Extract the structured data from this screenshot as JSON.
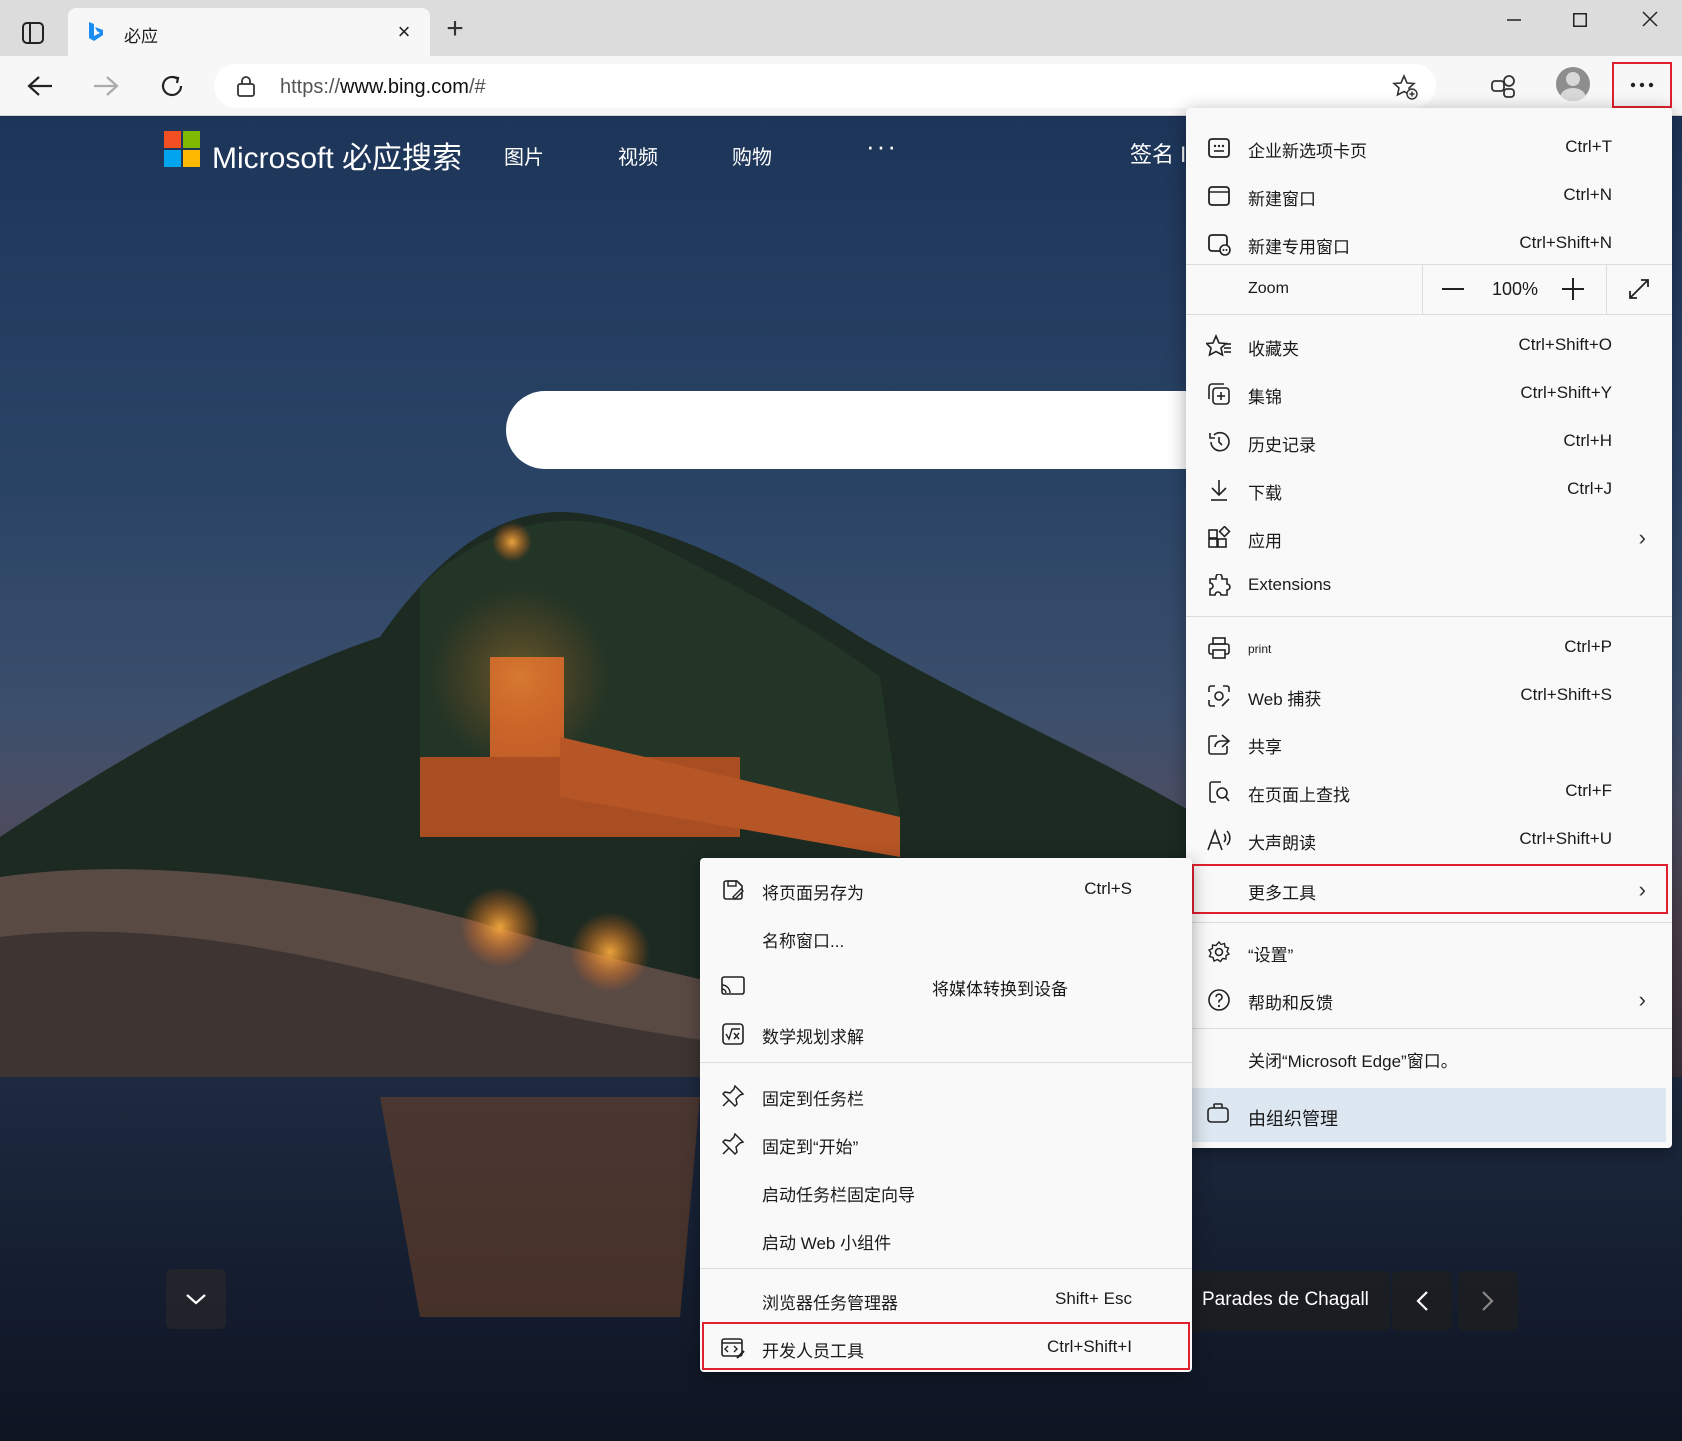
{
  "browser": {
    "tab_title": "必应",
    "url_scheme": "https://",
    "url_host": "www.bing.com",
    "url_path": "/#"
  },
  "page": {
    "brand": "Microsoft 必应搜索",
    "nav": [
      "图片",
      "视频",
      "购物"
    ],
    "nav_more": "···",
    "signin": "签名 I",
    "image_caption": "Parades de Chagall"
  },
  "menu": {
    "items_top": [
      {
        "label": "企业新选项卡页",
        "shortcut": "Ctrl+T",
        "icon": "business-tab-icon"
      },
      {
        "label": "新建窗口",
        "shortcut": "Ctrl+N",
        "icon": "new-window-icon"
      },
      {
        "label": "新建专用窗口",
        "shortcut": "Ctrl+Shift+N",
        "icon": "inprivate-window-icon"
      }
    ],
    "zoom_label": "Zoom",
    "zoom_value": "100%",
    "zoom_minus": "—",
    "zoom_plus": "+",
    "items_mid": [
      {
        "label": "收藏夹",
        "shortcut": "Ctrl+Shift+O",
        "icon": "favorites-icon"
      },
      {
        "label": "集锦",
        "shortcut": "Ctrl+Shift+Y",
        "icon": "collections-icon"
      },
      {
        "label": "历史记录",
        "shortcut": "Ctrl+H",
        "icon": "history-icon"
      },
      {
        "label": "下载",
        "shortcut": "Ctrl+J",
        "icon": "download-icon"
      },
      {
        "label": "应用",
        "shortcut": "",
        "icon": "apps-icon"
      },
      {
        "label": "Extensions",
        "shortcut": "",
        "icon": "extensions-icon"
      }
    ],
    "items_tools": [
      {
        "label": "print",
        "shortcut": "Ctrl+P",
        "icon": "print-icon"
      },
      {
        "label": "Web 捕获",
        "shortcut": "Ctrl+Shift+S",
        "icon": "web-capture-icon"
      },
      {
        "label": "共享",
        "shortcut": "",
        "icon": "share-icon"
      },
      {
        "label": "在页面上查找",
        "shortcut": "Ctrl+F",
        "icon": "find-icon"
      },
      {
        "label": "大声朗读",
        "shortcut": "Ctrl+Shift+U",
        "icon": "read-aloud-icon"
      },
      {
        "label": "更多工具",
        "shortcut": "",
        "icon": ""
      }
    ],
    "settings": "“设置”",
    "help": "帮助和反馈",
    "close": "关闭“Microsoft Edge”窗口。",
    "managed": "由组织管理",
    "chevron": "›"
  },
  "submenu": {
    "items": [
      {
        "label": "将页面另存为",
        "shortcut": "Ctrl+S",
        "icon": "save-page-icon"
      },
      {
        "label": "名称窗口...",
        "shortcut": "",
        "icon": ""
      },
      {
        "label": "将媒体转换到设备",
        "shortcut": "",
        "icon": "cast-icon"
      },
      {
        "label": "数学规划求解",
        "shortcut": "",
        "icon": "math-solver-icon"
      }
    ],
    "pin_items": [
      {
        "label": "固定到任务栏",
        "icon": "pin-icon"
      },
      {
        "label": "固定到“开始”",
        "icon": "pin-icon"
      },
      {
        "label": "启动任务栏固定向导",
        "icon": ""
      },
      {
        "label": "启动 Web 小组件",
        "icon": ""
      }
    ],
    "task_manager": {
      "label": "浏览器任务管理器",
      "shortcut": "Shift+ Esc"
    },
    "devtools": {
      "label": "开发人员工具",
      "shortcut": "Ctrl+Shift+I"
    }
  },
  "colors": {
    "highlight_red": "#e0202e",
    "menu_bg": "#f9f9f9",
    "managed_bg": "#dde7f1"
  }
}
